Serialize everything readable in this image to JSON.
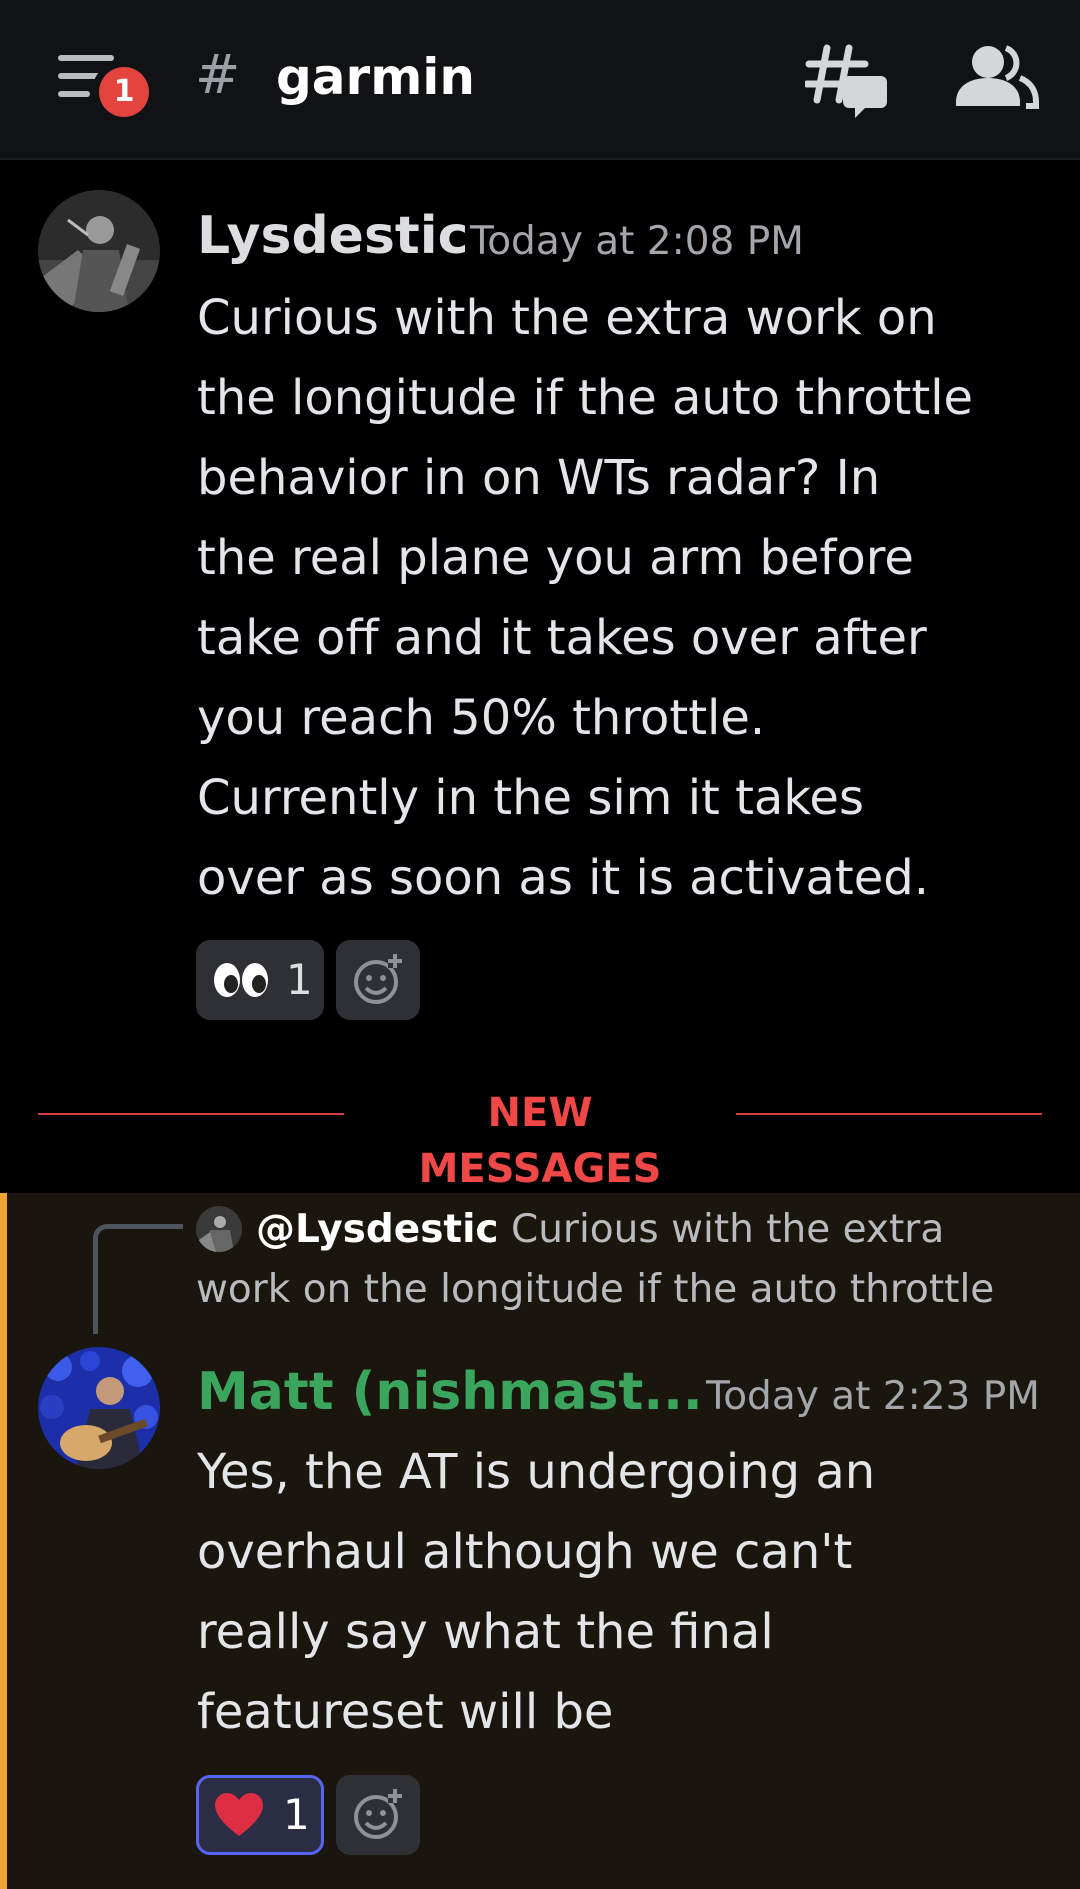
{
  "header": {
    "channel_hash": "#",
    "channel_name": "garmin",
    "badge_count": "1"
  },
  "messages": [
    {
      "author": "Lysdestic",
      "author_color": "#ffffff",
      "timestamp": "Today at 2:08 PM",
      "text": "Curious with the extra work on\nthe longitude if the auto throttle\nbehavior in on WTs radar? In\nthe real plane you arm before\ntake off and it takes over after\nyou reach 50% throttle.\nCurrently in the sim it takes\nover as soon as it is activated.",
      "reaction": {
        "emoji": "eyes-icon",
        "count": "1"
      }
    },
    {
      "reply": {
        "author": "@Lysdestic",
        "snippet": "Curious with the extra work on the longitude if the auto throttle"
      },
      "author": "Matt (nishmast...",
      "author_color": "#3ba55d",
      "timestamp": "Today at 2:23 PM",
      "text": "Yes, the AT is undergoing an\noverhaul although we can't\nreally say what the final\nfeatureset will be",
      "reaction": {
        "emoji": "heart-icon",
        "count": "1"
      }
    }
  ],
  "divider": {
    "label": "NEW MESSAGES"
  },
  "colors": {
    "accent_mention": "#f0a232",
    "new_messages": "#f04747",
    "reaction_active_border": "#5865f2"
  }
}
